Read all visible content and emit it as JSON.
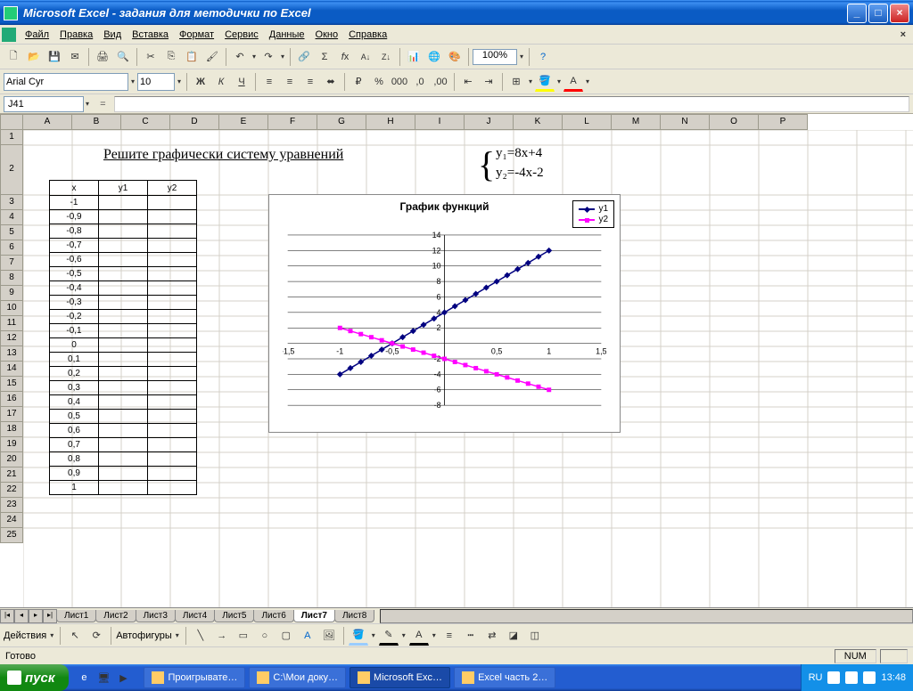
{
  "title": "Microsoft Excel - задания для методички по Excel",
  "menu": {
    "file": "Файл",
    "edit": "Правка",
    "view": "Вид",
    "insert": "Вставка",
    "format": "Формат",
    "tools": "Сервис",
    "data": "Данные",
    "window": "Окно",
    "help": "Справка"
  },
  "toolbar": {
    "font": "Arial Cyr",
    "size": "10",
    "zoom": "100%"
  },
  "formula": {
    "name_box": "J41",
    "fx": "="
  },
  "columns": [
    "A",
    "B",
    "C",
    "D",
    "E",
    "F",
    "G",
    "H",
    "I",
    "J",
    "K",
    "L",
    "M",
    "N",
    "O",
    "P"
  ],
  "rows": [
    1,
    2,
    3,
    4,
    5,
    6,
    7,
    8,
    9,
    10,
    11,
    12,
    13,
    14,
    15,
    16,
    17,
    18,
    19,
    20,
    21,
    22,
    23,
    24,
    25
  ],
  "heading": "Решите графически систему уравнений",
  "eq1": "y₁=8x+4",
  "eq2": "y₂=-4x-2",
  "table": {
    "h_x": "x",
    "h_y1": "y1",
    "h_y2": "y2",
    "rows": [
      "-1",
      "-0,9",
      "-0,8",
      "-0,7",
      "-0,6",
      "-0,5",
      "-0,4",
      "-0,3",
      "-0,2",
      "-0,1",
      "0",
      "0,1",
      "0,2",
      "0,3",
      "0,4",
      "0,5",
      "0,6",
      "0,7",
      "0,8",
      "0,9",
      "1"
    ]
  },
  "chart_data": {
    "type": "line",
    "title": "График функций",
    "x": [
      -1,
      -0.9,
      -0.8,
      -0.7,
      -0.6,
      -0.5,
      -0.4,
      -0.3,
      -0.2,
      -0.1,
      0,
      0.1,
      0.2,
      0.3,
      0.4,
      0.5,
      0.6,
      0.7,
      0.8,
      0.9,
      1
    ],
    "series": [
      {
        "name": "y1",
        "values": [
          -4,
          -3.2,
          -2.4,
          -1.6,
          -0.8,
          0,
          0.8,
          1.6,
          2.4,
          3.2,
          4,
          4.8,
          5.6,
          6.4,
          7.2,
          8,
          8.8,
          9.6,
          10.4,
          11.2,
          12
        ],
        "color": "#000080"
      },
      {
        "name": "y2",
        "values": [
          2,
          1.6,
          1.2,
          0.8,
          0.4,
          0,
          -0.4,
          -0.8,
          -1.2,
          -1.6,
          -2,
          -2.4,
          -2.8,
          -3.2,
          -3.6,
          -4,
          -4.4,
          -4.8,
          -5.2,
          -5.6,
          -6
        ],
        "color": "#ff00ff"
      }
    ],
    "xticks": [
      -1.5,
      -1,
      -0.5,
      0,
      0.5,
      1,
      1.5
    ],
    "xtick_labels": [
      "-1,5",
      "-1",
      "-0,5",
      "0",
      "0,5",
      "1",
      "1,5"
    ],
    "yticks": [
      -8,
      -6,
      -4,
      -2,
      0,
      2,
      4,
      6,
      8,
      10,
      12,
      14
    ],
    "xlim": [
      -1.5,
      1.5
    ],
    "ylim": [
      -8,
      14
    ]
  },
  "sheets": {
    "tabs": [
      "Лист1",
      "Лист2",
      "Лист3",
      "Лист4",
      "Лист5",
      "Лист6",
      "Лист7",
      "Лист8"
    ],
    "active": 6
  },
  "draw": {
    "actions": "Действия",
    "autoshapes": "Автофигуры"
  },
  "status": {
    "ready": "Готово",
    "num": "NUM"
  },
  "taskbar": {
    "start": "пуск",
    "buttons": [
      "Проигрывате…",
      "С:\\Мои доку…",
      "Microsoft Exc…",
      "Excel часть 2…"
    ],
    "active": 2,
    "lang": "RU",
    "time": "13:48"
  }
}
